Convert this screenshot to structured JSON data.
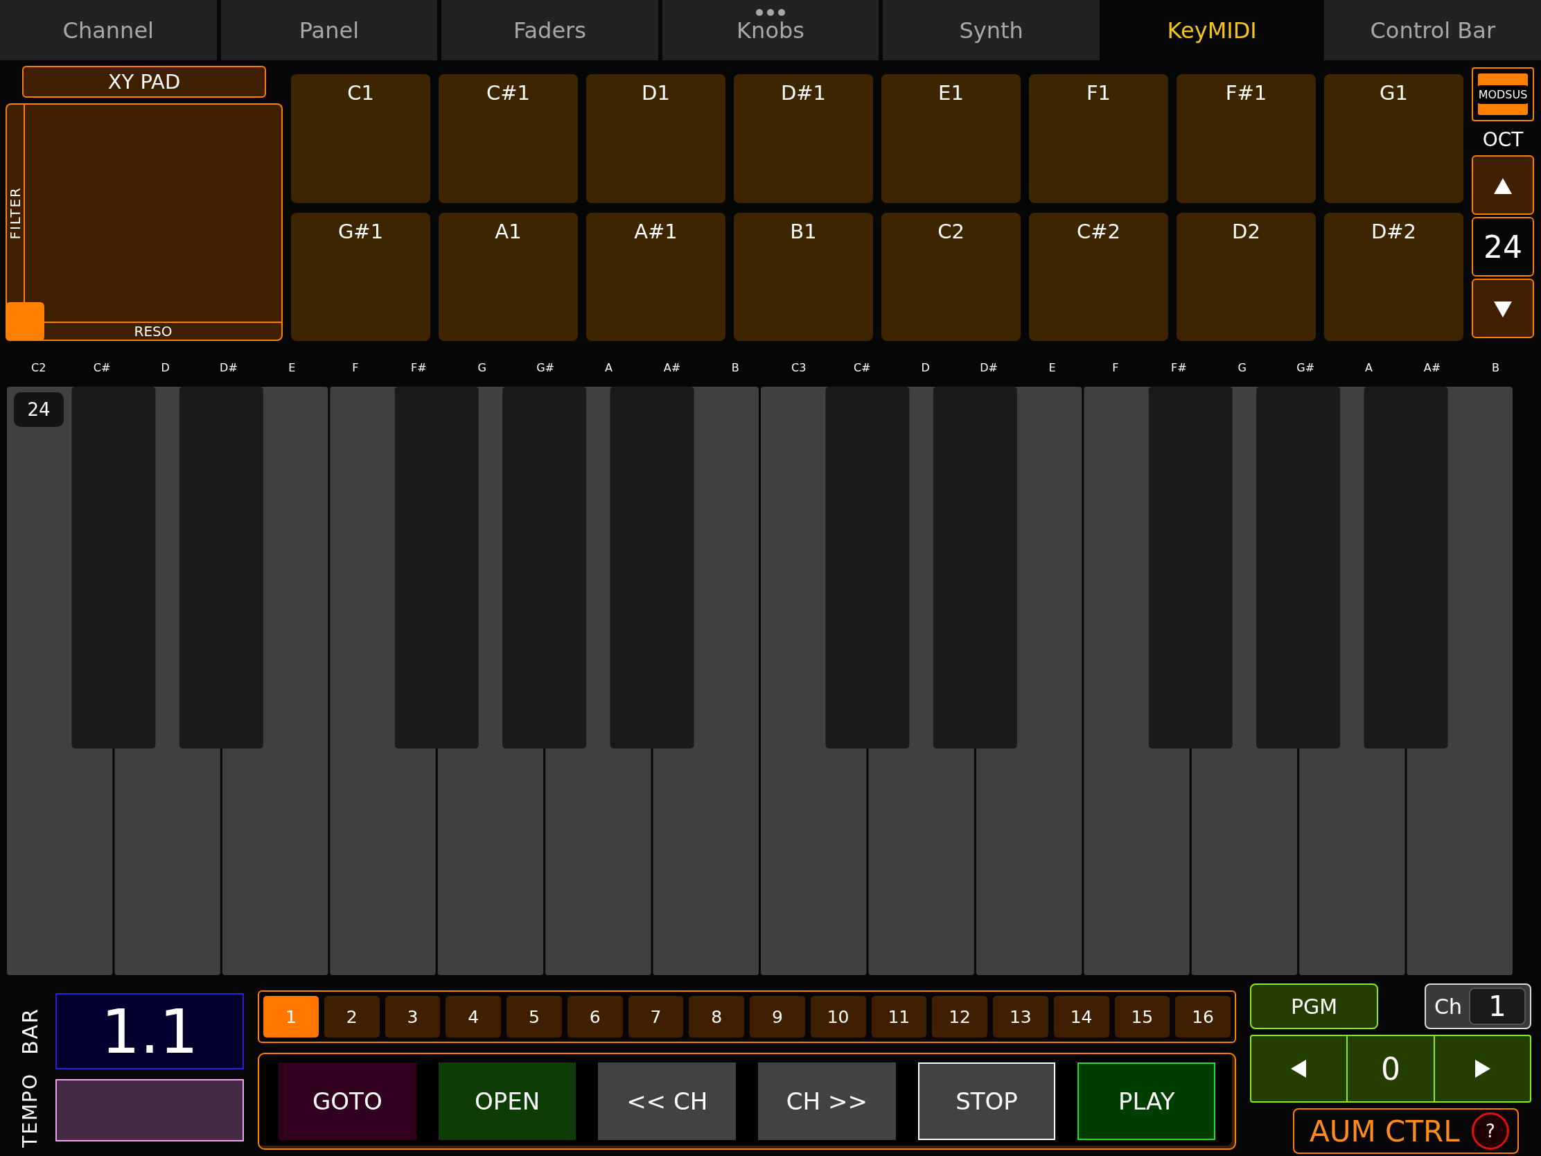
{
  "tabs": [
    {
      "label": "Channel",
      "selected": false
    },
    {
      "label": "Panel",
      "selected": false
    },
    {
      "label": "Faders",
      "selected": false
    },
    {
      "label": "Knobs",
      "selected": false
    },
    {
      "label": "Synth",
      "selected": false
    },
    {
      "label": "KeyMIDI",
      "selected": true
    },
    {
      "label": "Control Bar",
      "selected": false
    }
  ],
  "xy_pad": {
    "title": "XY PAD",
    "y_label": "FILTER",
    "x_label": "RESO"
  },
  "pads": [
    "C1",
    "C#1",
    "D1",
    "D#1",
    "E1",
    "F1",
    "F#1",
    "G1",
    "G#1",
    "A1",
    "A#1",
    "B1",
    "C2",
    "C#2",
    "D2",
    "D#2"
  ],
  "octave_panel": {
    "mod_button": "MODSUS",
    "label": "OCT",
    "value": "24"
  },
  "keyboard": {
    "note_labels": [
      "C2",
      "C#",
      "D",
      "D#",
      "E",
      "F",
      "F#",
      "G",
      "G#",
      "A",
      "A#",
      "B",
      "C3",
      "C#",
      "D",
      "D#",
      "E",
      "F",
      "F#",
      "G",
      "G#",
      "A",
      "A#",
      "B"
    ],
    "octave_badge": "24"
  },
  "position": {
    "bar_label": "BAR",
    "bar_value": "1.1",
    "tempo_label": "TEMPO"
  },
  "steps": [
    {
      "label": "1",
      "selected": true
    },
    {
      "label": "2",
      "selected": false
    },
    {
      "label": "3",
      "selected": false
    },
    {
      "label": "4",
      "selected": false
    },
    {
      "label": "5",
      "selected": false
    },
    {
      "label": "6",
      "selected": false
    },
    {
      "label": "7",
      "selected": false
    },
    {
      "label": "8",
      "selected": false
    },
    {
      "label": "9",
      "selected": false
    },
    {
      "label": "10",
      "selected": false
    },
    {
      "label": "11",
      "selected": false
    },
    {
      "label": "12",
      "selected": false
    },
    {
      "label": "13",
      "selected": false
    },
    {
      "label": "14",
      "selected": false
    },
    {
      "label": "15",
      "selected": false
    },
    {
      "label": "16",
      "selected": false
    }
  ],
  "transport": [
    {
      "label": "GOTO",
      "kind": "cue"
    },
    {
      "label": "OPEN",
      "kind": "load"
    },
    {
      "label": "<< CH",
      "kind": "nav"
    },
    {
      "label": "CH >>",
      "kind": "nav"
    },
    {
      "label": "STOP",
      "kind": "stop"
    },
    {
      "label": "PLAY",
      "kind": "play"
    }
  ],
  "program": {
    "button": "PGM",
    "channel_label": "Ch",
    "channel": "1",
    "value": "0"
  },
  "aum": {
    "label": "AUM CTRL",
    "help": "?"
  }
}
